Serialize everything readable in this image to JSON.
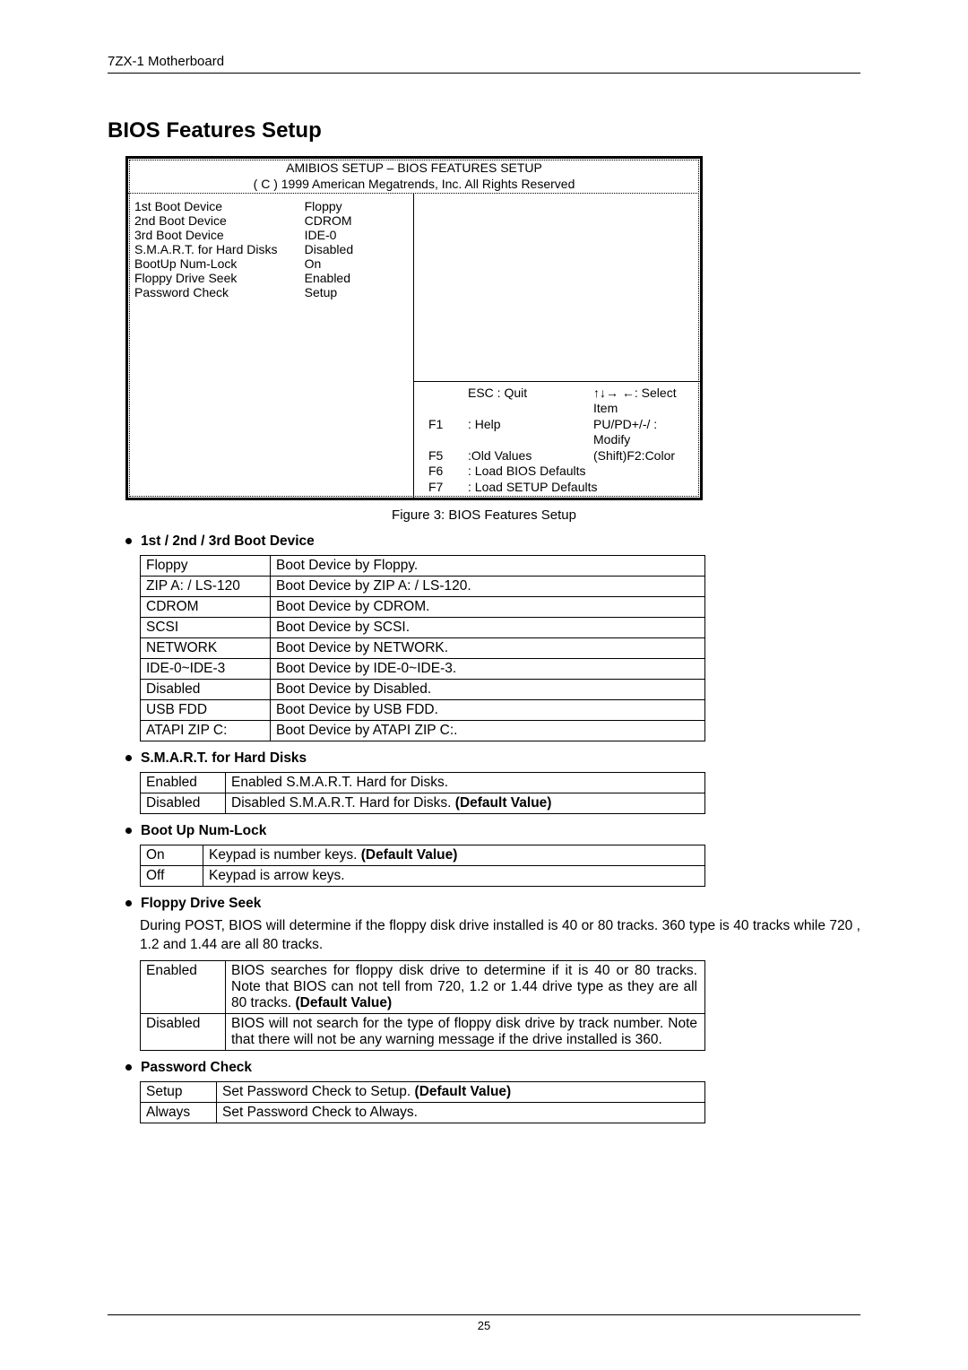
{
  "header": "7ZX-1 Motherboard",
  "section_title": "BIOS Features Setup",
  "bios_box": {
    "title_line1": "AMIBIOS SETUP – BIOS FEATURES SETUP",
    "title_line2": "( C ) 1999 American Megatrends, Inc. All Rights Reserved",
    "settings": [
      {
        "label": "1st Boot Device",
        "value": "Floppy"
      },
      {
        "label": "2nd Boot Device",
        "value": "CDROM"
      },
      {
        "label": "3rd Boot Device",
        "value": "IDE-0"
      },
      {
        "label": "S.M.A.R.T. for Hard Disks",
        "value": "Disabled"
      },
      {
        "label": "BootUp Num-Lock",
        "value": "On"
      },
      {
        "label": "Floppy Drive Seek",
        "value": "Enabled"
      },
      {
        "label": "Password Check",
        "value": "Setup"
      }
    ],
    "help": {
      "top_left": "ESC : Quit",
      "top_right": "↑↓→ ←: Select Item",
      "rows": [
        {
          "k": "F1",
          "a": ": Help",
          "b": "PU/PD+/-/ : Modify"
        },
        {
          "k": "F5",
          "a": ":Old Values",
          "b": "(Shift)F2:Color"
        },
        {
          "k": "F6",
          "a": ": Load BIOS Defaults",
          "b": ""
        },
        {
          "k": "F7",
          "a": ": Load SETUP Defaults",
          "b": ""
        }
      ]
    }
  },
  "figure_caption": "Figure 3: BIOS Features Setup",
  "sections": {
    "boot_device": {
      "title": "1st / 2nd / 3rd Boot Device",
      "rows": [
        [
          "Floppy",
          "Boot Device by Floppy."
        ],
        [
          "ZIP A: / LS-120",
          "Boot Device by ZIP A: / LS-120."
        ],
        [
          "CDROM",
          "Boot Device by CDROM."
        ],
        [
          "SCSI",
          "Boot Device by SCSI."
        ],
        [
          "NETWORK",
          "Boot Device by NETWORK."
        ],
        [
          "IDE-0~IDE-3",
          "Boot Device by IDE-0~IDE-3."
        ],
        [
          "Disabled",
          "Boot Device by Disabled."
        ],
        [
          "USB FDD",
          "Boot Device by USB FDD."
        ],
        [
          "ATAPI ZIP C:",
          "Boot Device by ATAPI ZIP C:."
        ]
      ]
    },
    "smart": {
      "title": "S.M.A.R.T. for Hard Disks",
      "rows": [
        [
          "Enabled",
          "Enabled S.M.A.R.T. Hard for Disks.",
          false
        ],
        [
          "Disabled",
          "Disabled S.M.A.R.T. Hard for Disks.",
          true
        ]
      ]
    },
    "numlock": {
      "title": "Boot Up Num-Lock",
      "rows": [
        [
          "On",
          "Keypad is number keys.",
          true
        ],
        [
          "Off",
          "Keypad is arrow keys.",
          false
        ]
      ]
    },
    "floppy_seek": {
      "title": "Floppy Drive Seek",
      "para": "During POST, BIOS will determine if the floppy disk drive installed is 40 or 80 tracks. 360 type is 40 tracks while 720 , 1.2 and 1.44 are all 80 tracks.",
      "rows": [
        [
          "Enabled",
          "BIOS searches for floppy disk drive to determine if it is 40 or 80 tracks. Note that BIOS can not tell from 720, 1.2 or 1.44 drive type as they are all 80 tracks.",
          true
        ],
        [
          "Disabled",
          "BIOS will not search for the type of floppy disk drive by track number. Note that there will not be any warning message if the drive installed is 360.",
          false
        ]
      ]
    },
    "pwd": {
      "title": "Password Check",
      "rows": [
        [
          "Setup",
          "Set Password Check to Setup.",
          true
        ],
        [
          "Always",
          "Set Password Check to Always.",
          false
        ]
      ]
    }
  },
  "default_label": "(Default Value)",
  "page_number": "25"
}
